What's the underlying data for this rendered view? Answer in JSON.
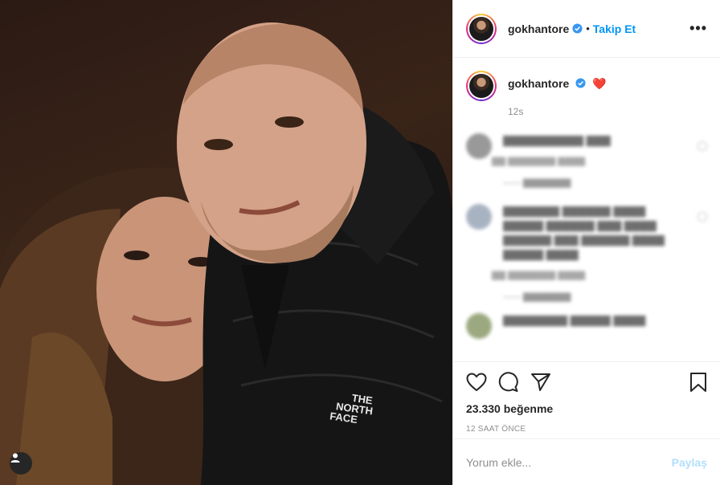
{
  "header": {
    "username": "gokhantore",
    "separator": "•",
    "follow_label": "Takip Et",
    "more_label": "•••"
  },
  "caption": {
    "username": "gokhantore",
    "emoji": "❤️",
    "time": "12s"
  },
  "photo": {
    "jacket_logo_line1": "THE",
    "jacket_logo_line2": "NORTH",
    "jacket_logo_line3": "FACE"
  },
  "actions": {
    "likes": "23.330 beğenme",
    "time_ago": "12 SAAT ÖNCE"
  },
  "comment_box": {
    "placeholder": "Yorum ekle...",
    "post_label": "Paylaş"
  },
  "icons": {
    "like": "heart-icon",
    "comment": "comment-icon",
    "share": "share-icon",
    "save": "bookmark-icon",
    "verified": "verified-badge-icon",
    "tag": "user-tag-icon"
  },
  "colors": {
    "accent": "#0095f6",
    "verified": "#3897f0",
    "post_disabled": "#b2dffc",
    "heart": "#ed4956"
  }
}
